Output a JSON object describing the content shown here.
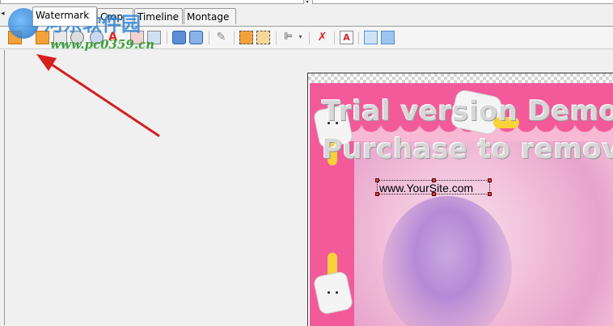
{
  "tabs": [
    {
      "label": "Watermark",
      "active": true
    },
    {
      "label": "Crop",
      "active": false
    },
    {
      "label": "Timeline",
      "active": false
    },
    {
      "label": "Montage",
      "active": false
    }
  ],
  "tab_scroll_left": "◂",
  "toolbar": {
    "icons": [
      "rotate-icon",
      "image-add-icon",
      "rectangle-select-icon",
      "ellipse-select-icon",
      "text-icon",
      "text-add-icon",
      "image-watermark-icon",
      "image-frame-icon",
      "blur-icon",
      "eraser-icon",
      "pen-icon",
      "bring-front-icon",
      "send-back-icon",
      "align-icon",
      "align-dropdown-icon",
      "clear-icon",
      "text-properties-icon",
      "preview-icon",
      "apply-icon"
    ]
  },
  "canvas": {
    "watermark_line1": "Trial version Demo.",
    "watermark_line2": "Purchase to remove",
    "site_text": "www.YourSite.com"
  },
  "overlay": {
    "logo_cn": "河东软件园",
    "logo_url": "www.pc0359.cn"
  },
  "colors": {
    "card_pink": "#f35a9a",
    "arrow_red": "#d61f1f"
  }
}
